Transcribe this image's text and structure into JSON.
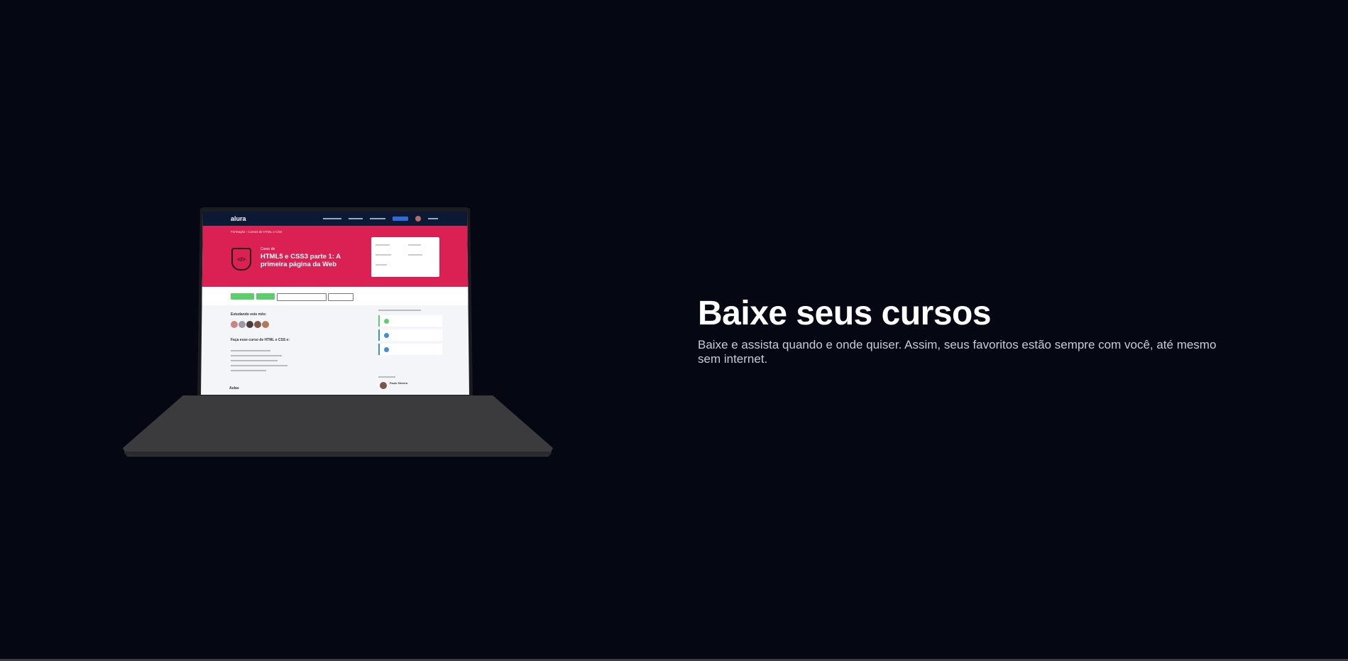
{
  "hero": {
    "title": "Baixe seus cursos",
    "description": "Baixe e assista quando e onde quiser. Assim, seus favoritos estão sempre com você, até mesmo sem internet."
  },
  "laptop_screen": {
    "logo": "alura",
    "breadcrumb": "Formação › Cursos de HTML e CSS",
    "course_kicker": "Curso de",
    "course_title": "HTML5 e CSS3 parte 1: A primeira página da Web",
    "studying_label": "Estudando este mês:",
    "about_heading": "Faça esse curso de HTML e CSS e:",
    "lessons_heading": "Aulas",
    "instructor_name": "Paulo Silveira",
    "colors": {
      "nav": "#0b1935",
      "hero": "#db2154",
      "accent_green": "#5ccf6d"
    }
  },
  "colors": {
    "background": "#050813",
    "title": "#ffffff",
    "description": "#c9ccd6"
  }
}
